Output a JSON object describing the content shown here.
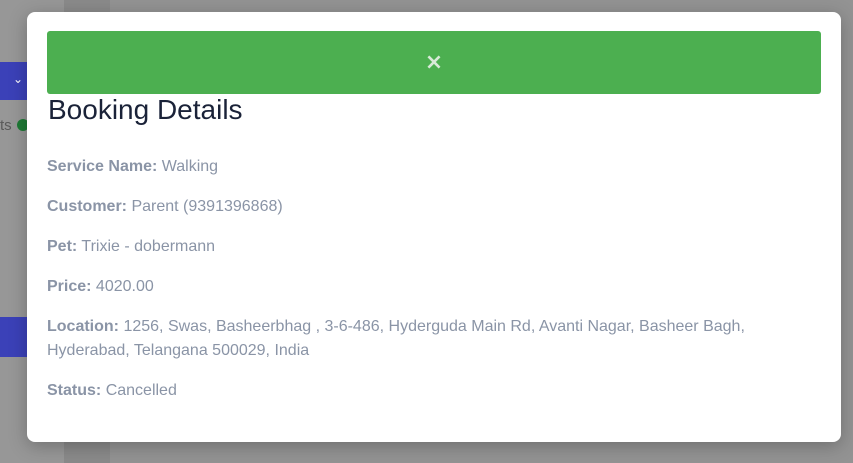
{
  "background": {
    "status_text_fragment": "ts"
  },
  "modal": {
    "close_icon": "×",
    "title": "Booking Details",
    "details": {
      "service_label": "Service Name:",
      "service_value": "Walking",
      "customer_label": "Customer:",
      "customer_value": "Parent (9391396868)",
      "pet_label": "Pet:",
      "pet_value": "Trixie - dobermann",
      "price_label": "Price:",
      "price_value": "4020.00",
      "location_label": "Location:",
      "location_value": "1256, Swas, Basheerbhag , 3-6-486, Hyderguda Main Rd, Avanti Nagar, Basheer Bagh, Hyderabad, Telangana 500029, India",
      "status_label": "Status:",
      "status_value": "Cancelled"
    }
  },
  "colors": {
    "close_bar": "#4caf50",
    "title": "#1a2238",
    "detail_text": "#8a94a6",
    "backdrop": "#8f8f8f",
    "bg_button": "#3b41b8"
  }
}
